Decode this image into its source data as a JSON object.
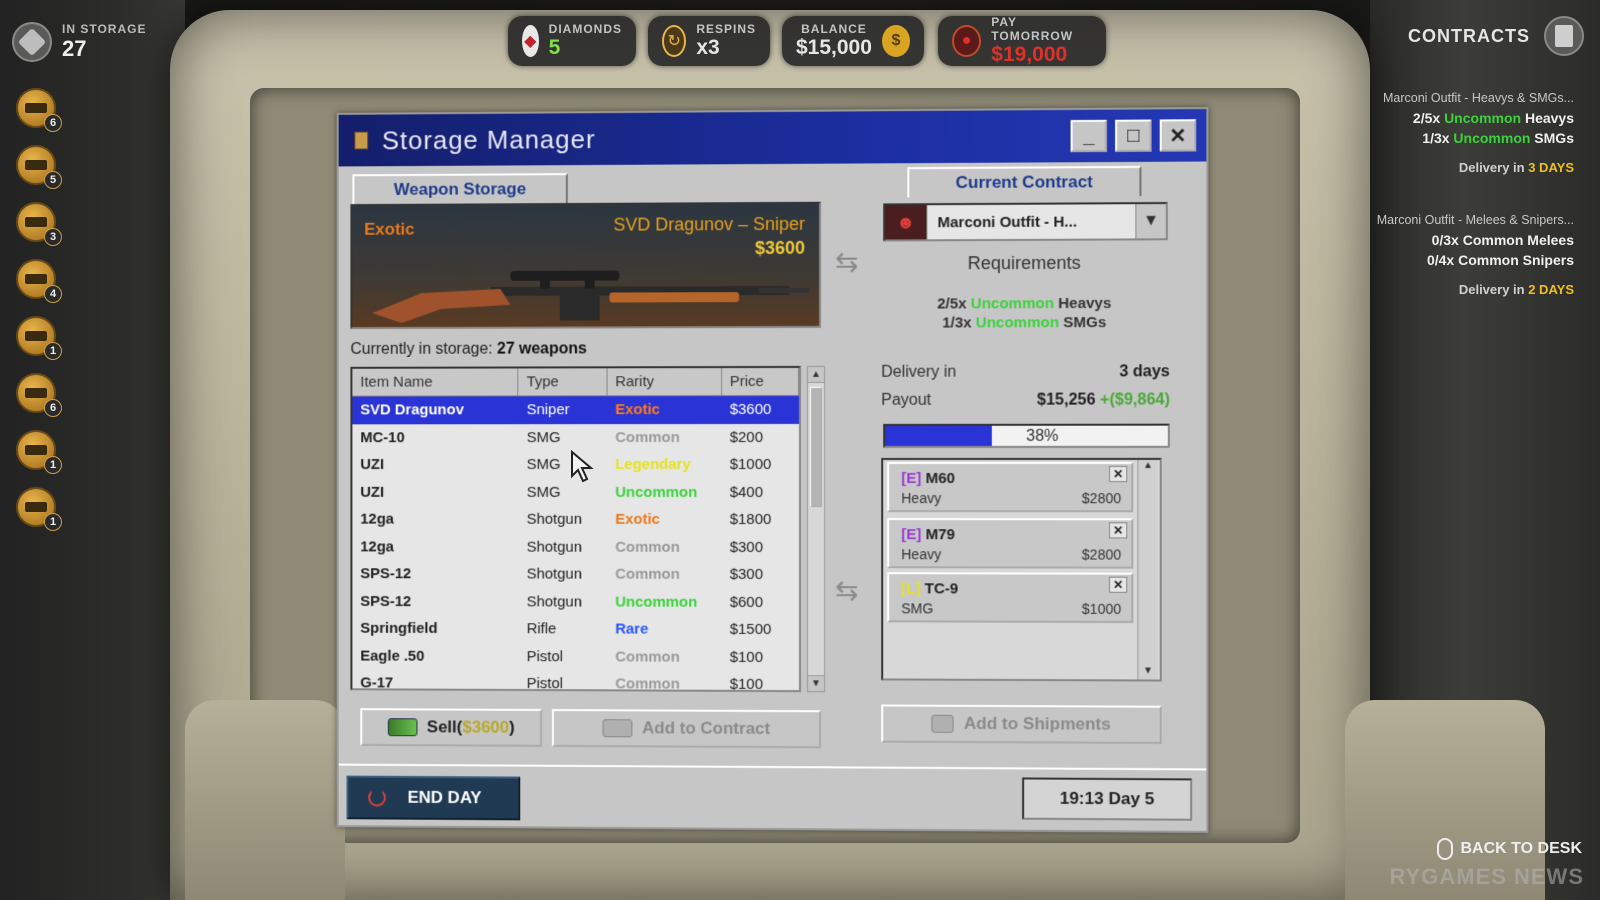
{
  "hud": {
    "storage_label": "IN STORAGE",
    "storage_count": "27",
    "weapon_counts": [
      "6",
      "5",
      "3",
      "4",
      "1",
      "6",
      "1",
      "1"
    ],
    "diamonds_label": "DIAMONDS",
    "diamonds_value": "5",
    "respins_label": "RESPINS",
    "respins_value": "x3",
    "balance_label": "BALANCE",
    "balance_value": "$15,000",
    "pay_label": "PAY TOMORROW",
    "pay_value": "$19,000",
    "contracts_label": "CONTRACTS",
    "back_label": "BACK TO DESK",
    "watermark": "RYGAMES NEWS",
    "colors": {
      "pay_red": "#e0302a",
      "diamonds_green": "#7ee04a",
      "delivery_gold": "#f0c020"
    }
  },
  "hud_contracts": [
    {
      "title": "Marconi Outfit - Heavys & SMGs...",
      "req1_count": "2/5x ",
      "req1_rarity": "Uncommon",
      "req1_type": " Heavys",
      "req2_count": "1/3x ",
      "req2_rarity": "Uncommon",
      "req2_type": " SMGs",
      "delivery_prefix": "Delivery in ",
      "delivery_days": "3 DAYS"
    },
    {
      "title": "Marconi Outfit - Melees & Snipers...",
      "req1_count": "0/3x ",
      "req1_rarity": "Common",
      "req1_type": " Melees",
      "req2_count": "0/4x ",
      "req2_rarity": "Common",
      "req2_type": " Snipers",
      "delivery_prefix": "Delivery in ",
      "delivery_days": "2 DAYS"
    }
  ],
  "window": {
    "title": "Storage Manager",
    "tab_left": "Weapon Storage",
    "tab_right": "Current Contract"
  },
  "preview": {
    "rarity": "Exotic",
    "name": "SVD Dragunov – Sniper",
    "price": "$3600"
  },
  "storage": {
    "prefix": "Currently in storage:",
    "count": "27 weapons"
  },
  "table": {
    "headers": [
      "Item Name",
      "Type",
      "Rarity",
      "Price"
    ],
    "rows": [
      {
        "name": "SVD Dragunov",
        "type": "Sniper",
        "rarity": "Exotic",
        "price": "$3600",
        "selected": true
      },
      {
        "name": "MC-10",
        "type": "SMG",
        "rarity": "Common",
        "price": "$200"
      },
      {
        "name": "UZI",
        "type": "SMG",
        "rarity": "Legendary",
        "price": "$1000"
      },
      {
        "name": "UZI",
        "type": "SMG",
        "rarity": "Uncommon",
        "price": "$400"
      },
      {
        "name": "12ga",
        "type": "Shotgun",
        "rarity": "Exotic",
        "price": "$1800"
      },
      {
        "name": "12ga",
        "type": "Shotgun",
        "rarity": "Common",
        "price": "$300"
      },
      {
        "name": "SPS-12",
        "type": "Shotgun",
        "rarity": "Common",
        "price": "$300"
      },
      {
        "name": "SPS-12",
        "type": "Shotgun",
        "rarity": "Uncommon",
        "price": "$600"
      },
      {
        "name": "Springfield",
        "type": "Rifle",
        "rarity": "Rare",
        "price": "$1500"
      },
      {
        "name": "Eagle .50",
        "type": "Pistol",
        "rarity": "Common",
        "price": "$100"
      },
      {
        "name": "G-17",
        "type": "Pistol",
        "rarity": "Common",
        "price": "$100"
      }
    ]
  },
  "buttons": {
    "sell_label": "Sell(",
    "sell_price": "$3600",
    "sell_close": ")",
    "add_contract": "Add to Contract",
    "add_shipments": "Add to Shipments",
    "end_day": "END DAY"
  },
  "contract": {
    "selected": "Marconi Outfit - H...",
    "requirements_title": "Requirements",
    "req1_count": "2/5x ",
    "req1_rarity": "Uncommon",
    "req1_type": " Heavys",
    "req2_count": "1/3x ",
    "req2_rarity": "Uncommon",
    "req2_type": " SMGs",
    "delivery_label": "Delivery in",
    "delivery_value": "3 days",
    "payout_label": "Payout",
    "payout_value": "$15,256",
    "payout_delta": "+($9,864)",
    "progress_percent": 38,
    "progress_label": "38%",
    "items": [
      {
        "tag": "[E]",
        "name": "M60",
        "type": "Heavy",
        "price": "$2800",
        "tag_color": "#9a3ad6"
      },
      {
        "tag": "[E]",
        "name": "M79",
        "type": "Heavy",
        "price": "$2800",
        "tag_color": "#9a3ad6"
      },
      {
        "tag": "[L]",
        "name": "TC-9",
        "type": "SMG",
        "price": "$1000",
        "tag_color": "#e6e21e"
      }
    ]
  },
  "clock": "19:13 Day 5",
  "rarity_colors": {
    "Exotic": "#e87a1e",
    "Common": "#9a9a9a",
    "Uncommon": "#3cd23c",
    "Legendary": "#e6e21e",
    "Rare": "#2a56ff"
  }
}
